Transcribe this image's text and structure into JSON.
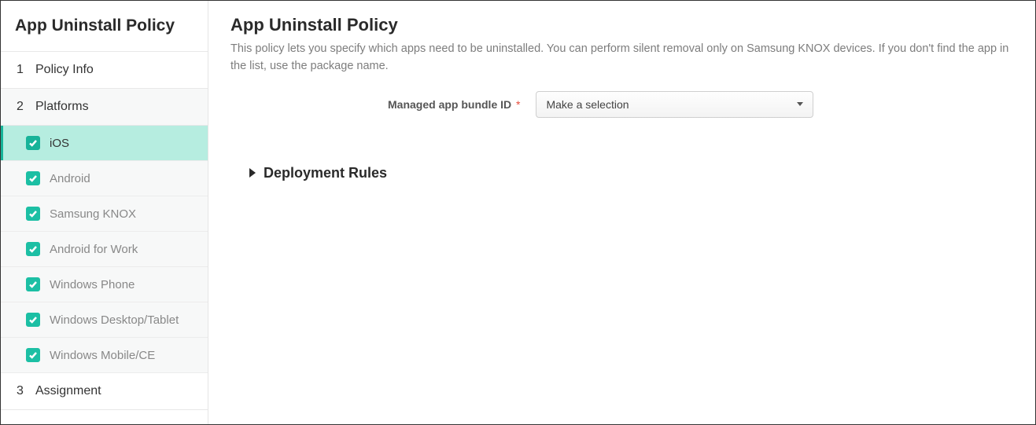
{
  "sidebar": {
    "title": "App Uninstall Policy",
    "steps": [
      {
        "num": "1",
        "label": "Policy Info"
      },
      {
        "num": "2",
        "label": "Platforms"
      },
      {
        "num": "3",
        "label": "Assignment"
      }
    ],
    "platforms": [
      {
        "label": "iOS",
        "checked": true,
        "active": true
      },
      {
        "label": "Android",
        "checked": true,
        "active": false
      },
      {
        "label": "Samsung KNOX",
        "checked": true,
        "active": false
      },
      {
        "label": "Android for Work",
        "checked": true,
        "active": false
      },
      {
        "label": "Windows Phone",
        "checked": true,
        "active": false
      },
      {
        "label": "Windows Desktop/Tablet",
        "checked": true,
        "active": false
      },
      {
        "label": "Windows Mobile/CE",
        "checked": true,
        "active": false
      }
    ]
  },
  "main": {
    "title": "App Uninstall Policy",
    "description": "This policy lets you specify which apps need to be uninstalled. You can perform silent removal only on Samsung KNOX devices. If you don't find the app in the list, use the package name.",
    "form": {
      "bundle_id_label": "Managed app bundle ID",
      "bundle_id_required_mark": "*",
      "bundle_id_placeholder": "Make a selection"
    },
    "section": {
      "deployment_rules_label": "Deployment Rules"
    }
  }
}
